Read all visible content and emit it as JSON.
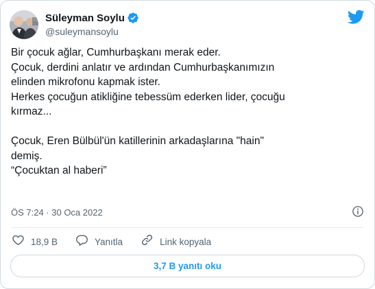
{
  "author": {
    "display_name": "Süleyman Soylu",
    "handle": "@suleymansoylu",
    "verified": true
  },
  "tweet": {
    "text": "Bir çocuk ağlar, Cumhurbaşkanı merak eder.\nÇocuk, derdini anlatır ve ardından Cumhurbaşkanımızın\nelinden mikrofonu kapmak ister.\nHerkes çocuğun atikliğine tebessüm ederken lider, çocuğu\nkırmaz...\n\nÇocuk, Eren Bülbül'ün katillerinin arkadaşlarına \"hain\"\ndemiş.\n“Çocuktan al haberi”",
    "timestamp": "ÖS 7:24 · 30 Oca 2022"
  },
  "actions": {
    "like_count": "18,9 B",
    "reply_label": "Yanıtla",
    "copy_link_label": "Link kopyala"
  },
  "replies_button": {
    "label": "3,7 B yanıtı oku"
  },
  "icons": {
    "brand": "twitter-bird-icon",
    "verified": "verified-badge-icon",
    "info": "info-icon",
    "like": "heart-icon",
    "reply": "speech-bubble-icon",
    "link": "link-icon"
  },
  "colors": {
    "accent": "#1d9bf0",
    "text": "#0f1419",
    "secondary_text": "#536471",
    "border": "#cfd9de"
  }
}
